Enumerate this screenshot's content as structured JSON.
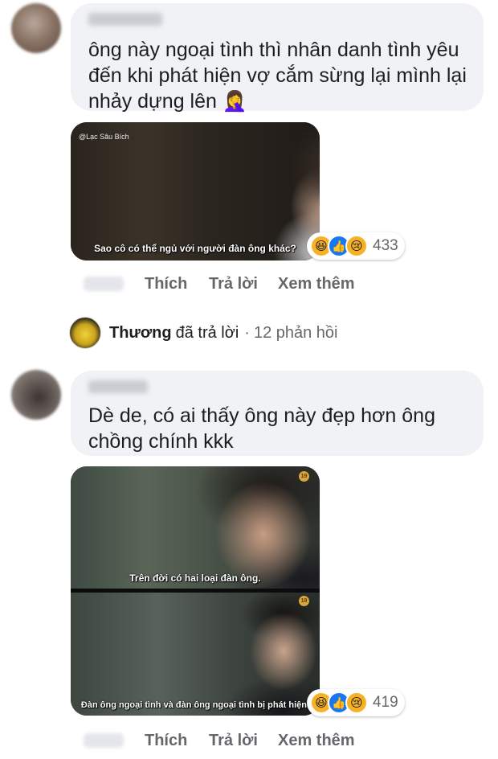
{
  "comment1": {
    "author": "Ngọc Trân",
    "text_lines": [
      "ông này ngoại tình thì nhân danh tình yêu",
      "đến khi phát hiện vợ cắm sừng lại mình lại",
      "nhảy dựng lên 🤦‍♀️"
    ],
    "media": {
      "watermark": "@Lạc Sâu Bích",
      "subtitle": "Sao cô có thể ngủ với người đàn ông khác?"
    },
    "reactions": {
      "icons": [
        "haha-icon",
        "like-icon",
        "sad-icon"
      ],
      "count": "433"
    },
    "actions": {
      "like": "Thích",
      "reply": "Trả lời",
      "more": "Xem thêm"
    }
  },
  "reply_summary": {
    "name": "Thương",
    "verb": "đã trả lời",
    "separator": "·",
    "count": "12 phản hồi"
  },
  "comment2": {
    "author": "Trân Bùi",
    "text_lines": [
      "Dè de, có ai thấy ông này đẹp hơn ông",
      "chồng chính kkk"
    ],
    "media": {
      "rating_top": "19",
      "subtitle_top": "Trên đời có hai loại đàn ông.",
      "rating_bottom": "19",
      "subtitle_bottom": "Đàn ông ngoại tình và đàn ông ngoại tình bị phát hiện."
    },
    "reactions": {
      "icons": [
        "haha-icon",
        "like-icon",
        "sad-icon"
      ],
      "count": "419"
    },
    "actions": {
      "like": "Thích",
      "reply": "Trả lời",
      "more": "Xem thêm"
    }
  },
  "colors": {
    "bubble": "#f0f2f5",
    "meta_text": "#65676b",
    "like_blue": "#1877f2",
    "emoji_yellow": "#f7b125"
  }
}
